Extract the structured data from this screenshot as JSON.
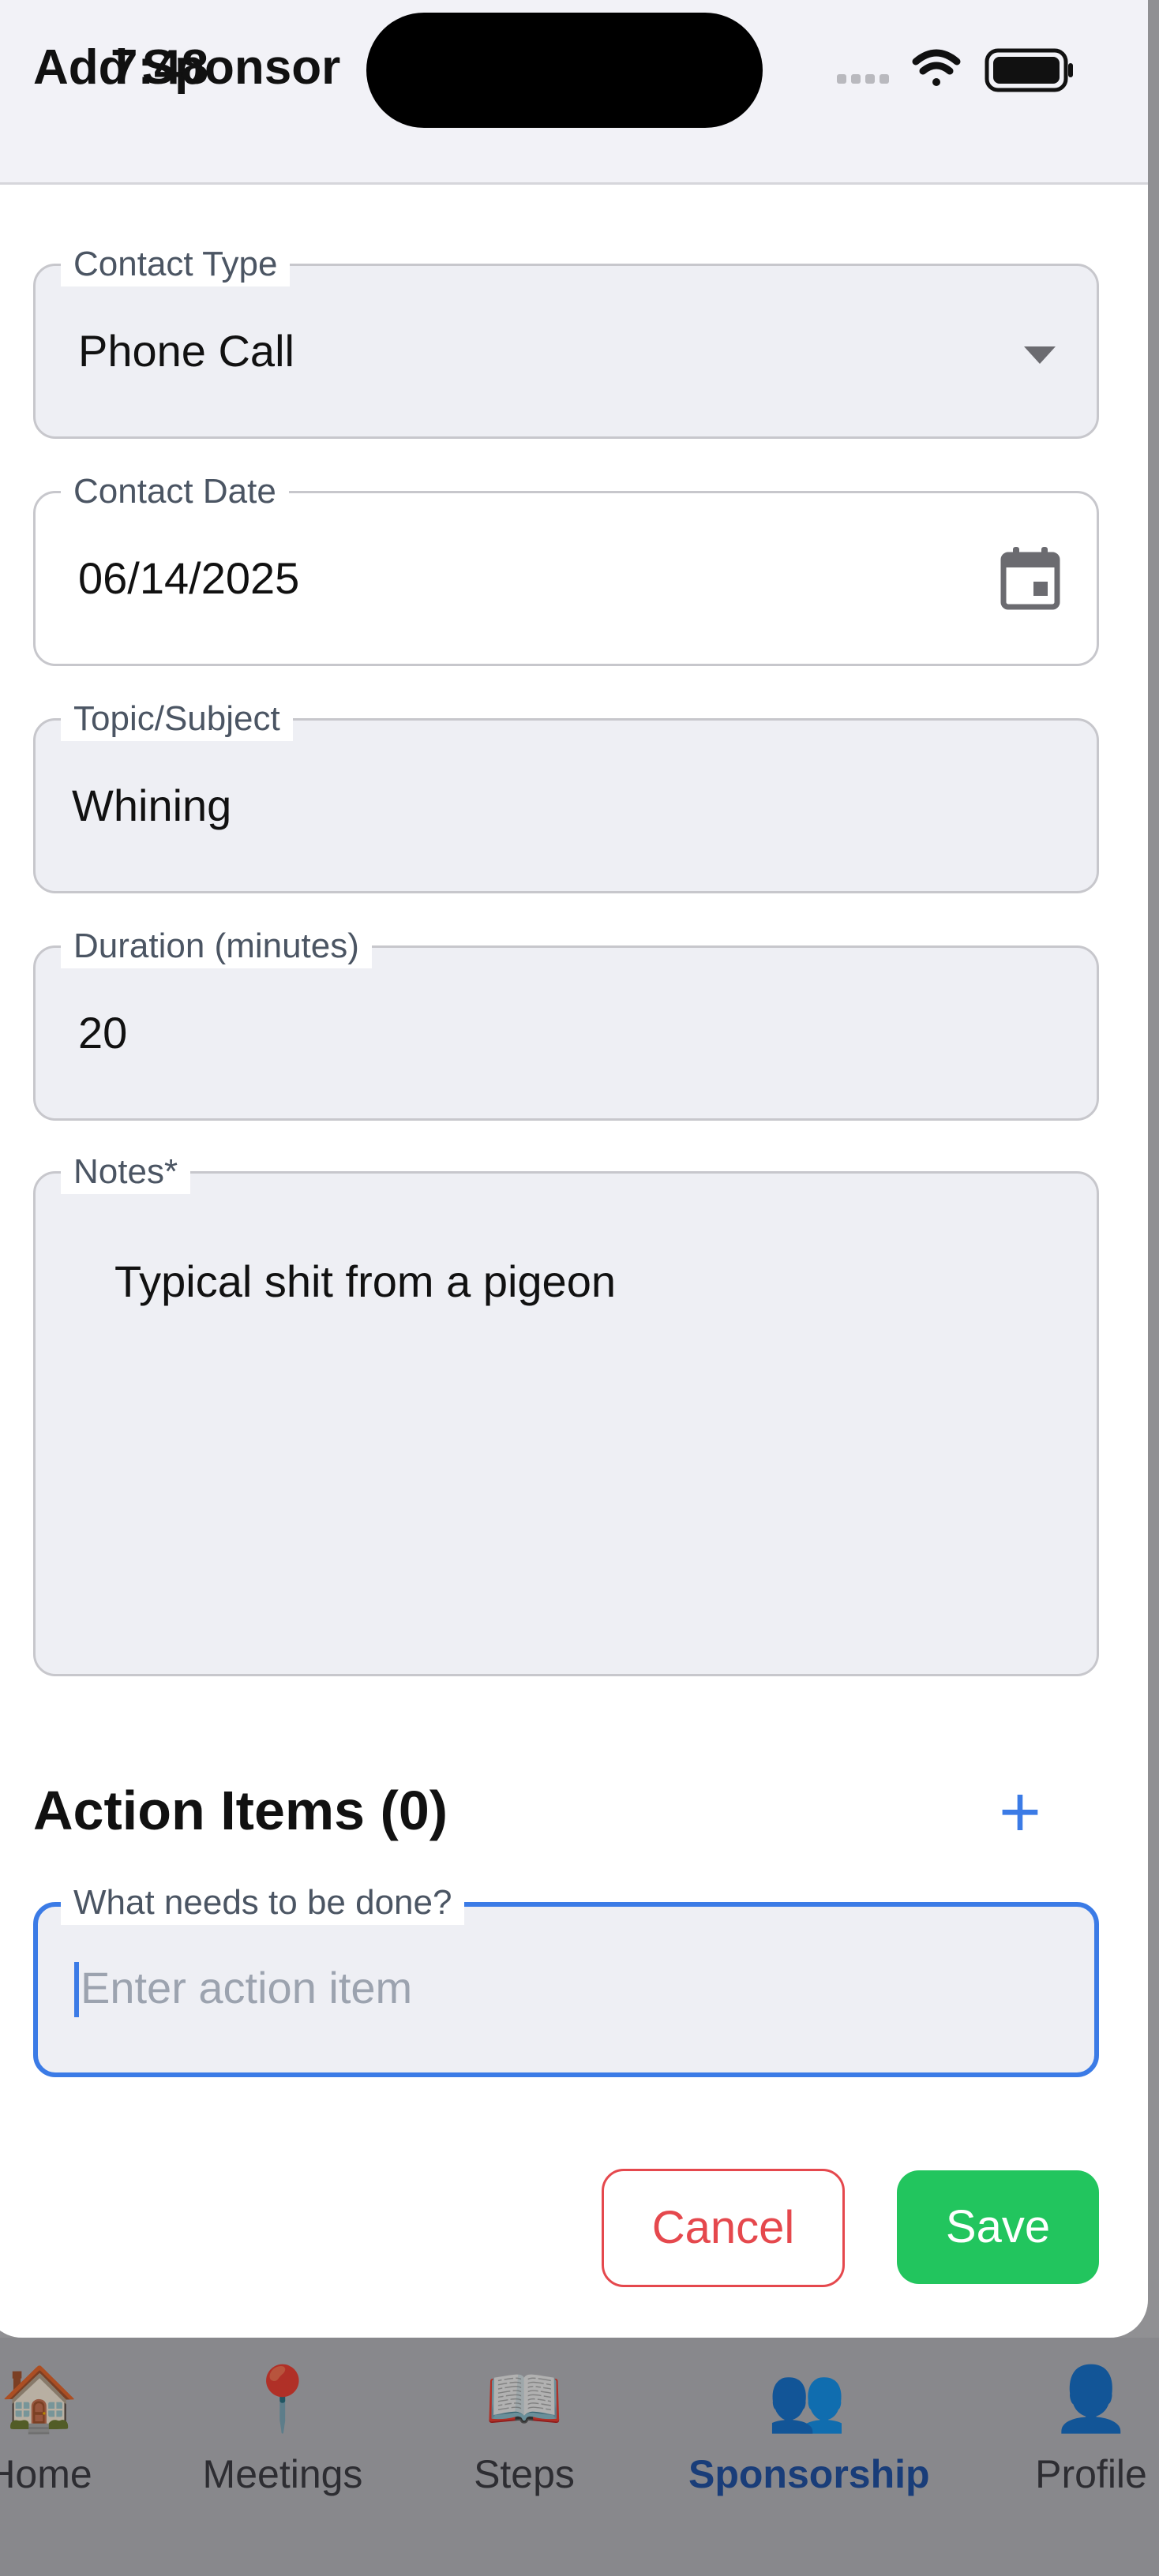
{
  "status_bar": {
    "time": "7:48"
  },
  "header": {
    "title": "Add Sponsor"
  },
  "form": {
    "contact_type": {
      "label": "Contact Type",
      "value": "Phone Call"
    },
    "contact_date": {
      "label": "Contact Date",
      "value": "06/14/2025"
    },
    "topic": {
      "label": "Topic/Subject",
      "value": "Whining"
    },
    "duration": {
      "label": "Duration (minutes)",
      "value": "20"
    },
    "notes": {
      "label": "Notes*",
      "value": "Typical shit from a pigeon"
    }
  },
  "action_items": {
    "title": "Action Items (0)",
    "add_label": "+",
    "input": {
      "label": "What needs to be done?",
      "placeholder": "Enter action item",
      "value": ""
    }
  },
  "buttons": {
    "cancel": "Cancel",
    "save": "Save"
  },
  "tabbar": {
    "items": [
      {
        "label": "Home",
        "icon": "house-icon"
      },
      {
        "label": "Meetings",
        "icon": "pushpin-icon"
      },
      {
        "label": "Steps",
        "icon": "open-book-icon"
      },
      {
        "label": "Sponsorship",
        "icon": "people-icon"
      },
      {
        "label": "Profile",
        "icon": "person-icon"
      }
    ],
    "active_index": 3
  },
  "colors": {
    "accent": "#3b7be6",
    "save": "#22c55e",
    "cancel": "#e5484d",
    "active_tab": "#2355a8"
  }
}
